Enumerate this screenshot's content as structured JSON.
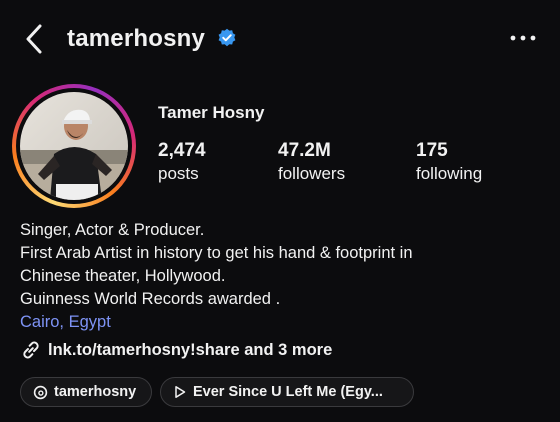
{
  "header": {
    "username": "tamerhosny",
    "verified": true
  },
  "profile": {
    "display_name": "Tamer Hosny",
    "stats": [
      {
        "value": "2,474",
        "label": "posts"
      },
      {
        "value": "47.2M",
        "label": "followers"
      },
      {
        "value": "175",
        "label": "following"
      }
    ],
    "bio_lines": [
      "Singer, Actor & Producer.",
      "First Arab Artist in history to get his hand & footprint in",
      "Chinese theater, Hollywood.",
      "Guinness World Records awarded ."
    ],
    "location": "Cairo, Egypt",
    "link_text": "lnk.to/tamerhosny!share and 3 more"
  },
  "chips": [
    {
      "icon": "threads-icon",
      "label": "tamerhosny"
    },
    {
      "icon": "play-icon",
      "label": "Ever Since U Left Me (Egy..."
    }
  ],
  "colors": {
    "background": "#0c0c0e",
    "verified_badge": "#3897f0",
    "location_link": "#7e93f5"
  }
}
